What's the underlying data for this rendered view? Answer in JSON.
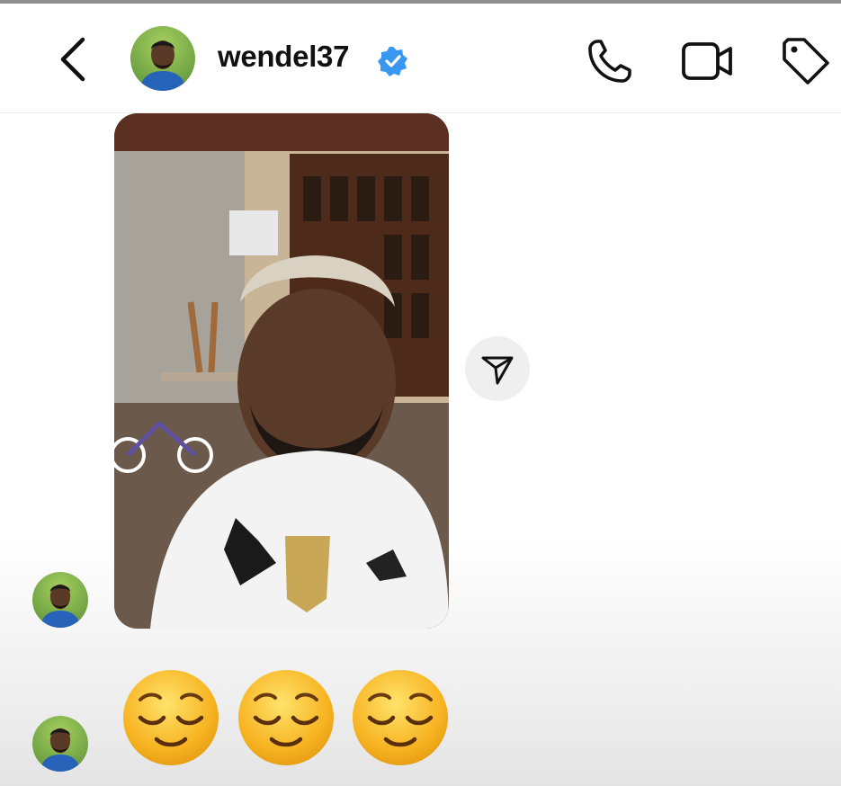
{
  "header": {
    "username": "wendel37",
    "verified": true,
    "icons": [
      "back-arrow-icon",
      "phone-icon",
      "video-camera-icon",
      "tag-icon"
    ]
  },
  "conversation": {
    "messages": [
      {
        "type": "photo",
        "description_icon": "selfie-photo",
        "share_icon": "send-icon"
      },
      {
        "type": "emoji",
        "emojis": [
          "relieved-face-icon",
          "relieved-face-icon",
          "relieved-face-icon"
        ]
      }
    ]
  },
  "colors": {
    "verified_blue": "#3897f0",
    "text": "#111111",
    "emoji_yellow": "#f7b321",
    "share_bg": "#efefef"
  }
}
